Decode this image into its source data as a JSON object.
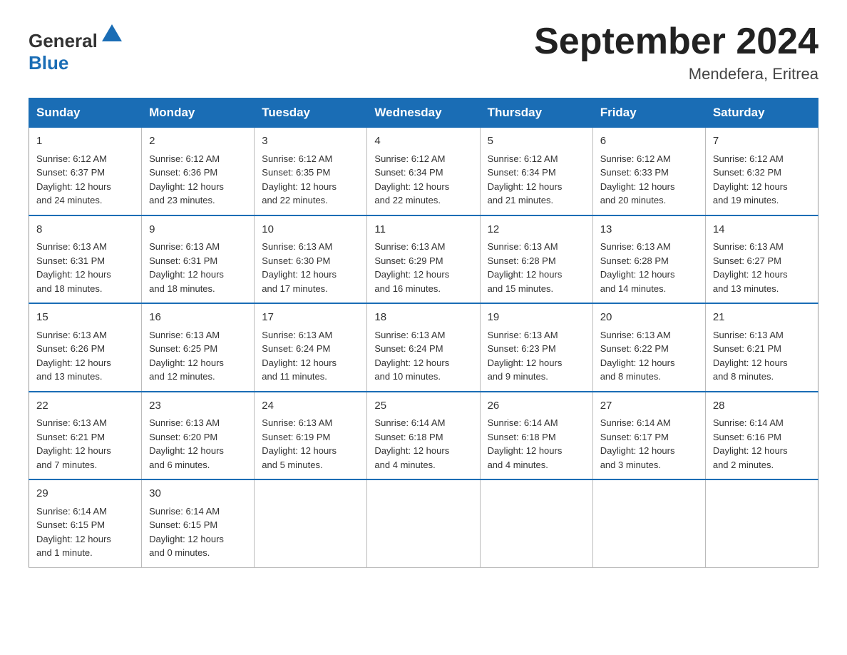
{
  "header": {
    "logo_general": "General",
    "logo_blue": "Blue",
    "month_title": "September 2024",
    "location": "Mendefera, Eritrea"
  },
  "days_of_week": [
    "Sunday",
    "Monday",
    "Tuesday",
    "Wednesday",
    "Thursday",
    "Friday",
    "Saturday"
  ],
  "weeks": [
    [
      {
        "day": "1",
        "sunrise": "6:12 AM",
        "sunset": "6:37 PM",
        "daylight": "12 hours and 24 minutes."
      },
      {
        "day": "2",
        "sunrise": "6:12 AM",
        "sunset": "6:36 PM",
        "daylight": "12 hours and 23 minutes."
      },
      {
        "day": "3",
        "sunrise": "6:12 AM",
        "sunset": "6:35 PM",
        "daylight": "12 hours and 22 minutes."
      },
      {
        "day": "4",
        "sunrise": "6:12 AM",
        "sunset": "6:34 PM",
        "daylight": "12 hours and 22 minutes."
      },
      {
        "day": "5",
        "sunrise": "6:12 AM",
        "sunset": "6:34 PM",
        "daylight": "12 hours and 21 minutes."
      },
      {
        "day": "6",
        "sunrise": "6:12 AM",
        "sunset": "6:33 PM",
        "daylight": "12 hours and 20 minutes."
      },
      {
        "day": "7",
        "sunrise": "6:12 AM",
        "sunset": "6:32 PM",
        "daylight": "12 hours and 19 minutes."
      }
    ],
    [
      {
        "day": "8",
        "sunrise": "6:13 AM",
        "sunset": "6:31 PM",
        "daylight": "12 hours and 18 minutes."
      },
      {
        "day": "9",
        "sunrise": "6:13 AM",
        "sunset": "6:31 PM",
        "daylight": "12 hours and 18 minutes."
      },
      {
        "day": "10",
        "sunrise": "6:13 AM",
        "sunset": "6:30 PM",
        "daylight": "12 hours and 17 minutes."
      },
      {
        "day": "11",
        "sunrise": "6:13 AM",
        "sunset": "6:29 PM",
        "daylight": "12 hours and 16 minutes."
      },
      {
        "day": "12",
        "sunrise": "6:13 AM",
        "sunset": "6:28 PM",
        "daylight": "12 hours and 15 minutes."
      },
      {
        "day": "13",
        "sunrise": "6:13 AM",
        "sunset": "6:28 PM",
        "daylight": "12 hours and 14 minutes."
      },
      {
        "day": "14",
        "sunrise": "6:13 AM",
        "sunset": "6:27 PM",
        "daylight": "12 hours and 13 minutes."
      }
    ],
    [
      {
        "day": "15",
        "sunrise": "6:13 AM",
        "sunset": "6:26 PM",
        "daylight": "12 hours and 13 minutes."
      },
      {
        "day": "16",
        "sunrise": "6:13 AM",
        "sunset": "6:25 PM",
        "daylight": "12 hours and 12 minutes."
      },
      {
        "day": "17",
        "sunrise": "6:13 AM",
        "sunset": "6:24 PM",
        "daylight": "12 hours and 11 minutes."
      },
      {
        "day": "18",
        "sunrise": "6:13 AM",
        "sunset": "6:24 PM",
        "daylight": "12 hours and 10 minutes."
      },
      {
        "day": "19",
        "sunrise": "6:13 AM",
        "sunset": "6:23 PM",
        "daylight": "12 hours and 9 minutes."
      },
      {
        "day": "20",
        "sunrise": "6:13 AM",
        "sunset": "6:22 PM",
        "daylight": "12 hours and 8 minutes."
      },
      {
        "day": "21",
        "sunrise": "6:13 AM",
        "sunset": "6:21 PM",
        "daylight": "12 hours and 8 minutes."
      }
    ],
    [
      {
        "day": "22",
        "sunrise": "6:13 AM",
        "sunset": "6:21 PM",
        "daylight": "12 hours and 7 minutes."
      },
      {
        "day": "23",
        "sunrise": "6:13 AM",
        "sunset": "6:20 PM",
        "daylight": "12 hours and 6 minutes."
      },
      {
        "day": "24",
        "sunrise": "6:13 AM",
        "sunset": "6:19 PM",
        "daylight": "12 hours and 5 minutes."
      },
      {
        "day": "25",
        "sunrise": "6:14 AM",
        "sunset": "6:18 PM",
        "daylight": "12 hours and 4 minutes."
      },
      {
        "day": "26",
        "sunrise": "6:14 AM",
        "sunset": "6:18 PM",
        "daylight": "12 hours and 4 minutes."
      },
      {
        "day": "27",
        "sunrise": "6:14 AM",
        "sunset": "6:17 PM",
        "daylight": "12 hours and 3 minutes."
      },
      {
        "day": "28",
        "sunrise": "6:14 AM",
        "sunset": "6:16 PM",
        "daylight": "12 hours and 2 minutes."
      }
    ],
    [
      {
        "day": "29",
        "sunrise": "6:14 AM",
        "sunset": "6:15 PM",
        "daylight": "12 hours and 1 minute."
      },
      {
        "day": "30",
        "sunrise": "6:14 AM",
        "sunset": "6:15 PM",
        "daylight": "12 hours and 0 minutes."
      },
      null,
      null,
      null,
      null,
      null
    ]
  ],
  "labels": {
    "sunrise": "Sunrise:",
    "sunset": "Sunset:",
    "daylight": "Daylight:"
  }
}
